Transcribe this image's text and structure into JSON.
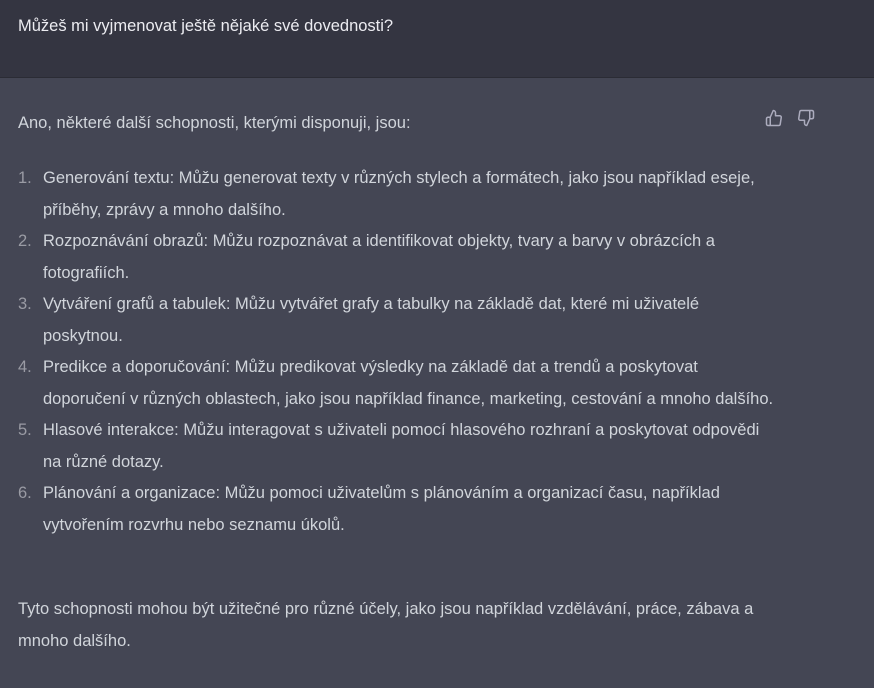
{
  "user": {
    "message": "Můžeš mi vyjmenovat ještě nějaké své dovednosti?"
  },
  "assistant": {
    "intro": "Ano, některé další schopnosti, kterými disponuji, jsou:",
    "items": [
      {
        "number": "1.",
        "text": "Generování textu: Můžu generovat texty v různých stylech a formátech, jako jsou například eseje, příběhy, zprávy a mnoho dalšího."
      },
      {
        "number": "2.",
        "text": "Rozpoznávání obrazů: Můžu rozpoznávat a identifikovat objekty, tvary a barvy v obrázcích a fotografiích."
      },
      {
        "number": "3.",
        "text": "Vytváření grafů a tabulek: Můžu vytvářet grafy a tabulky na základě dat, které mi uživatelé poskytnou."
      },
      {
        "number": "4.",
        "text": "Predikce a doporučování: Můžu predikovat výsledky na základě dat a trendů a poskytovat doporučení v různých oblastech, jako jsou například finance, marketing, cestování a mnoho dalšího."
      },
      {
        "number": "5.",
        "text": "Hlasové interakce: Můžu interagovat s uživateli pomocí hlasového rozhraní a poskytovat odpovědi na různé dotazy."
      },
      {
        "number": "6.",
        "text": "Plánování a organizace: Můžu pomoci uživatelům s plánováním a organizací času, například vytvořením rozvrhu nebo seznamu úkolů."
      }
    ],
    "closing": "Tyto schopnosti mohou být užitečné pro různé účely, jako jsou například vzdělávání, práce, zábava a mnoho dalšího."
  },
  "icons": {
    "thumbs_up": "thumbs-up-icon",
    "thumbs_down": "thumbs-down-icon"
  },
  "colors": {
    "user_bg": "#343541",
    "assistant_bg": "#444654",
    "text": "#d1d5db",
    "icon": "#acacbe"
  }
}
